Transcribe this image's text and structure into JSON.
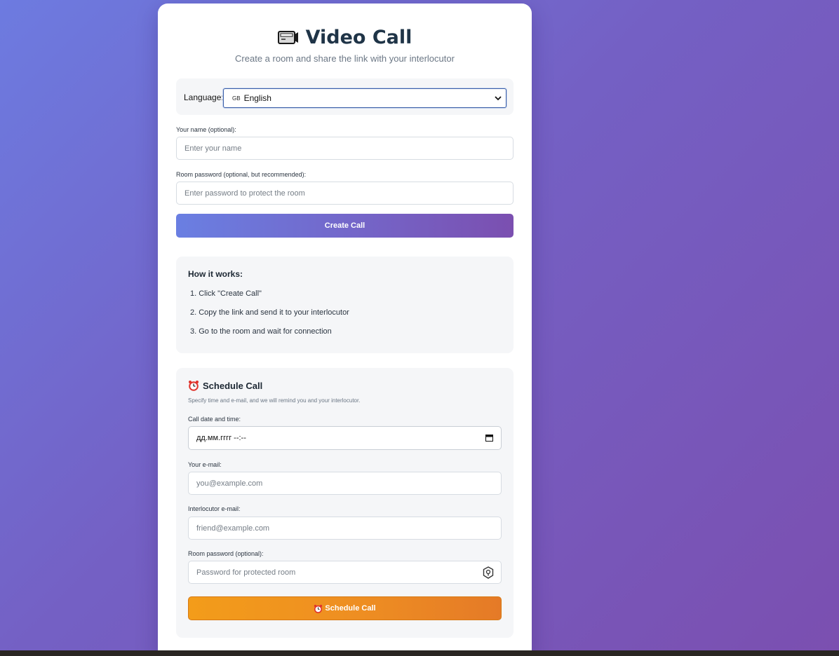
{
  "header": {
    "icon": "video-camera-icon",
    "title": "Video Call",
    "subtitle": "Create a room and share the link with your interlocutor"
  },
  "language": {
    "label": "Language:",
    "flag": "GB",
    "selected": "English"
  },
  "form": {
    "name_label": "Your name (optional):",
    "name_placeholder": "Enter your name",
    "password_label": "Room password (optional, but recommended):",
    "password_placeholder": "Enter password to protect the room",
    "create_button": "Create Call"
  },
  "how_it_works": {
    "title": "How it works:",
    "steps": [
      "1. Click \"Create Call\"",
      "2. Copy the link and send it to your interlocutor",
      "3. Go to the room and wait for connection"
    ]
  },
  "schedule": {
    "icon": "alarm-clock-icon",
    "title": "Schedule Call",
    "description": "Specify time and e-mail, and we will remind you and your interlocutor.",
    "datetime_label": "Call date and time:",
    "datetime_value": "дд.мм.гггг --:--",
    "email_label": "Your e-mail:",
    "email_placeholder": "you@example.com",
    "friend_email_label": "Interlocutor e-mail:",
    "friend_email_placeholder": "friend@example.com",
    "room_password_label": "Room password (optional):",
    "room_password_placeholder": "Password for protected room",
    "button": "Schedule Call"
  },
  "colors": {
    "background_gradient": [
      "#6d7be0",
      "#7b4fb0"
    ],
    "create_button_gradient": [
      "#6a7fe2",
      "#7b4fb0"
    ],
    "schedule_button_gradient": [
      "#f39c1a",
      "#e57a27"
    ],
    "heading": "#1f3447"
  }
}
